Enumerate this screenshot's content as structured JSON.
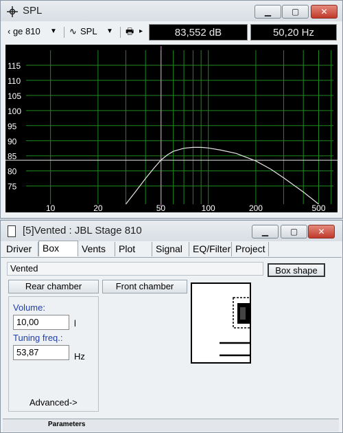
{
  "spl_window": {
    "title": "SPL",
    "toolbar": {
      "driver_select": "‹ ge 810",
      "curve_select": "SPL",
      "readout_db": "83,552 dB",
      "readout_hz": "50,20 Hz"
    },
    "window_buttons": {
      "minimize": "▁",
      "maximize": "▢",
      "close": "✕"
    }
  },
  "chart_data": {
    "type": "line",
    "x_scale": "log",
    "xlim": [
      7,
      620
    ],
    "ylim": [
      69,
      120
    ],
    "x_ticks": [
      "10",
      "20",
      "50",
      "100",
      "200",
      "500"
    ],
    "y_ticks": [
      "115",
      "110",
      "105",
      "100",
      "95",
      "90",
      "85",
      "80",
      "75"
    ],
    "grid": true,
    "cursor": {
      "x": 50.2,
      "y": 83.552
    },
    "series": [
      {
        "x": [
          30,
          35,
          40,
          45,
          50,
          55,
          60,
          70,
          80,
          90,
          100,
          120,
          150,
          200,
          250,
          300,
          400,
          500
        ],
        "y": [
          69,
          73.5,
          77.5,
          80.8,
          83.552,
          85.3,
          86.5,
          87.5,
          87.8,
          87.8,
          87.6,
          86.9,
          85.8,
          83.3,
          80.5,
          77.7,
          73,
          69
        ]
      }
    ],
    "colors": {
      "background": "#000000",
      "grid": "#1f8a1f",
      "curve": "#e6e6e6",
      "cursor": "#d28ed2",
      "labels": "#ffffff"
    }
  },
  "box_window": {
    "title": "[5]Vented : JBL Stage 810",
    "tabs": [
      "Driver",
      "Box",
      "Vents",
      "Plot",
      "Signal",
      "EQ/Filter",
      "Project"
    ],
    "active_tab": "Box",
    "box_type": "Vented",
    "box_shape_button": "Box shape",
    "rear_chamber_button": "Rear chamber",
    "front_chamber_button": "Front chamber",
    "volume_label": "Volume:",
    "volume_value": "10,00",
    "volume_unit": "l",
    "tuning_label": "Tuning freq.:",
    "tuning_value": "53,87",
    "tuning_unit": "Hz",
    "advanced_link": "Advanced->",
    "status": "Parameters"
  }
}
